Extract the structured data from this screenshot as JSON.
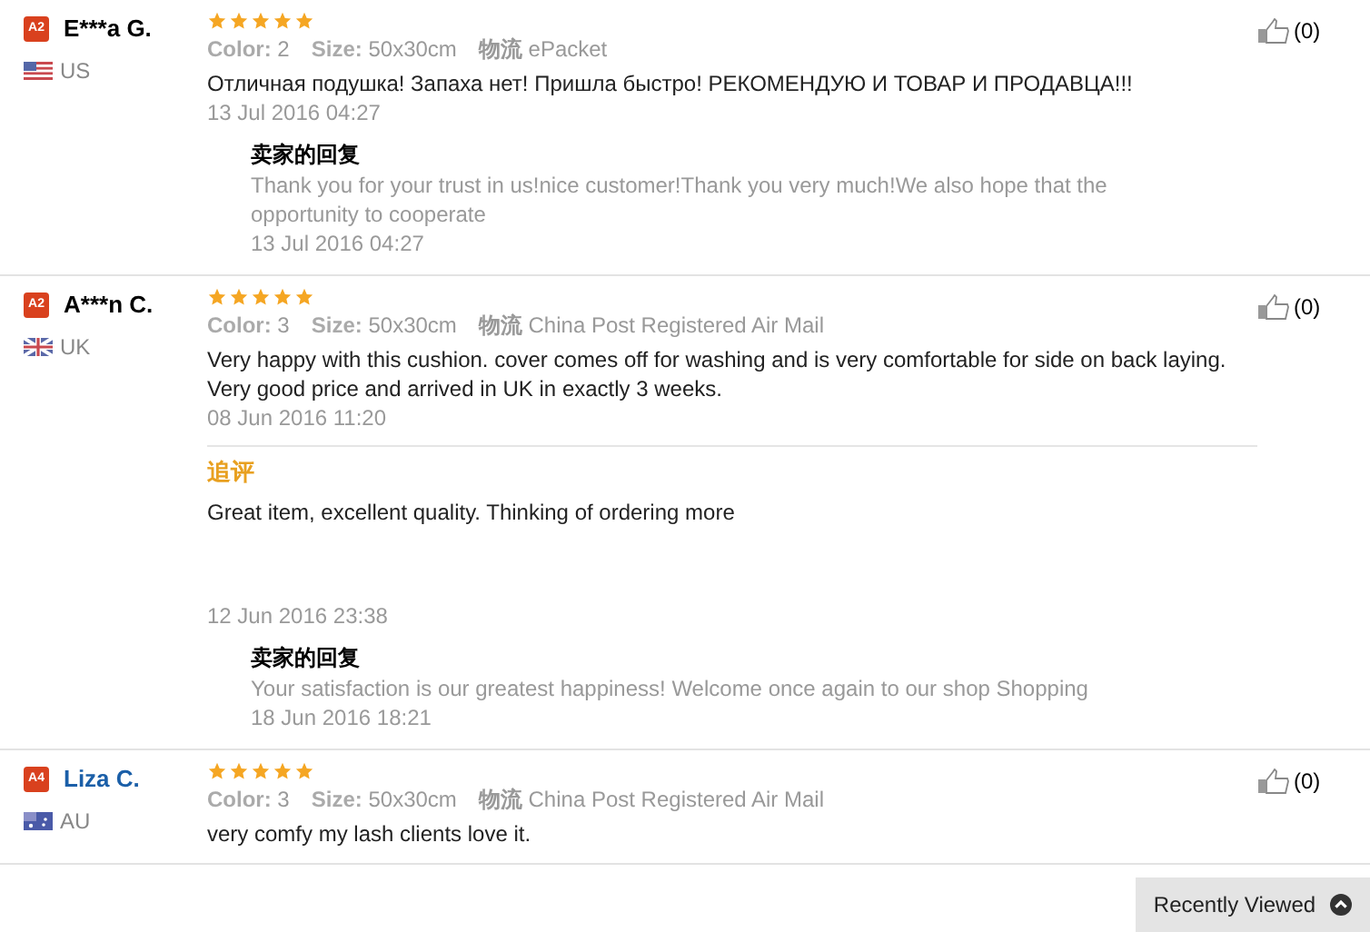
{
  "reviews": [
    {
      "level_badge": "A2",
      "name": "E***a G.",
      "color": "#000000",
      "country": "US",
      "flag": {
        "kind": "us"
      },
      "stars": 5,
      "meta": [
        {
          "label": "Color:",
          "value": "2"
        },
        {
          "label": "Size:",
          "value": "50x30cm"
        },
        {
          "label": "物流",
          "value": "ePacket"
        }
      ],
      "text": "Отличная подушка! Запаха нет! Пришла быстро! РЕКОМЕНДУЮ И ТОВАР И ПРОДАВЦА!!!",
      "date": "13 Jul 2016 04:27",
      "likes": "(0)",
      "seller_reply": {
        "label": "卖家的回复",
        "text": "Thank you for your trust in us!nice customer!Thank you very much!We also hope that the opportunity to cooperate",
        "date": "13 Jul 2016 04:27"
      }
    },
    {
      "level_badge": "A2",
      "name": "A***n C.",
      "color": "#000000",
      "country": "UK",
      "flag": {
        "kind": "uk"
      },
      "stars": 5,
      "meta": [
        {
          "label": "Color:",
          "value": "3"
        },
        {
          "label": "Size:",
          "value": "50x30cm"
        },
        {
          "label": "物流",
          "value": "China Post Registered Air Mail"
        }
      ],
      "text": "Very happy with this cushion. cover comes off for washing and is very comfortable for side on back laying. Very good price and arrived in UK in exactly 3 weeks.",
      "date": "08 Jun 2016 11:20",
      "likes": "(0)",
      "followup": {
        "label": "追评",
        "text": "Great item, excellent quality. Thinking of ordering more",
        "date": "12 Jun 2016 23:38"
      },
      "seller_reply": {
        "label": "卖家的回复",
        "text": "Your satisfaction is our greatest happiness! Welcome once again to our shop Shopping",
        "date": "18 Jun 2016 18:21"
      }
    },
    {
      "level_badge": "A4",
      "name": "Liza C.",
      "color": "#1b5fa8",
      "country": "AU",
      "flag": {
        "kind": "au"
      },
      "stars": 5,
      "meta": [
        {
          "label": "Color:",
          "value": "3"
        },
        {
          "label": "Size:",
          "value": "50x30cm"
        },
        {
          "label": "物流",
          "value": "China Post Registered Air Mail"
        }
      ],
      "text": "very comfy my lash clients love it.",
      "likes": "(0)"
    }
  ],
  "recently_viewed": {
    "label": "Recently Viewed"
  }
}
